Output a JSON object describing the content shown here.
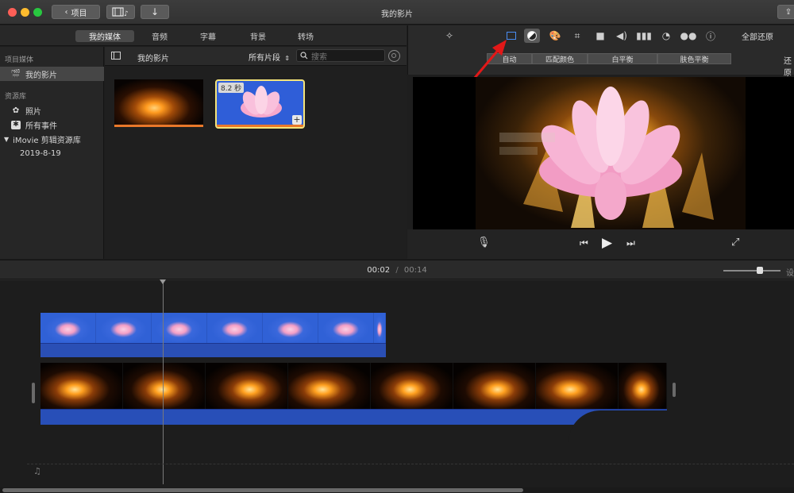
{
  "window": {
    "back_label": "项目",
    "title": "我的影片"
  },
  "tabs": [
    "我的媒体",
    "音频",
    "字幕",
    "背景",
    "转场"
  ],
  "sidebar": {
    "section_project": "项目媒体",
    "project_item": "我的影片",
    "section_library": "资源库",
    "library_items": [
      "照片",
      "所有事件"
    ],
    "library_name": "iMovie 剪辑资源库",
    "event_date": "2019-8-19"
  },
  "browser": {
    "title": "我的影片",
    "filter": "所有片段",
    "search_placeholder": "搜索",
    "clip2_duration": "8.2 秒"
  },
  "viewer_toolbar": {
    "reset_all": "全部还原",
    "reset": "还原",
    "segments": [
      "自动",
      "匹配颜色",
      "白平衡",
      "肤色平衡"
    ]
  },
  "timeline": {
    "current_time": "00:02",
    "separator": "/",
    "total_time": "00:14",
    "settings_label": "设"
  },
  "colors": {
    "accent_blue": "#3d73e0",
    "selection_yellow": "#f4e37a",
    "arrow_red": "#e21818",
    "clip_orange": "#e9782a"
  }
}
